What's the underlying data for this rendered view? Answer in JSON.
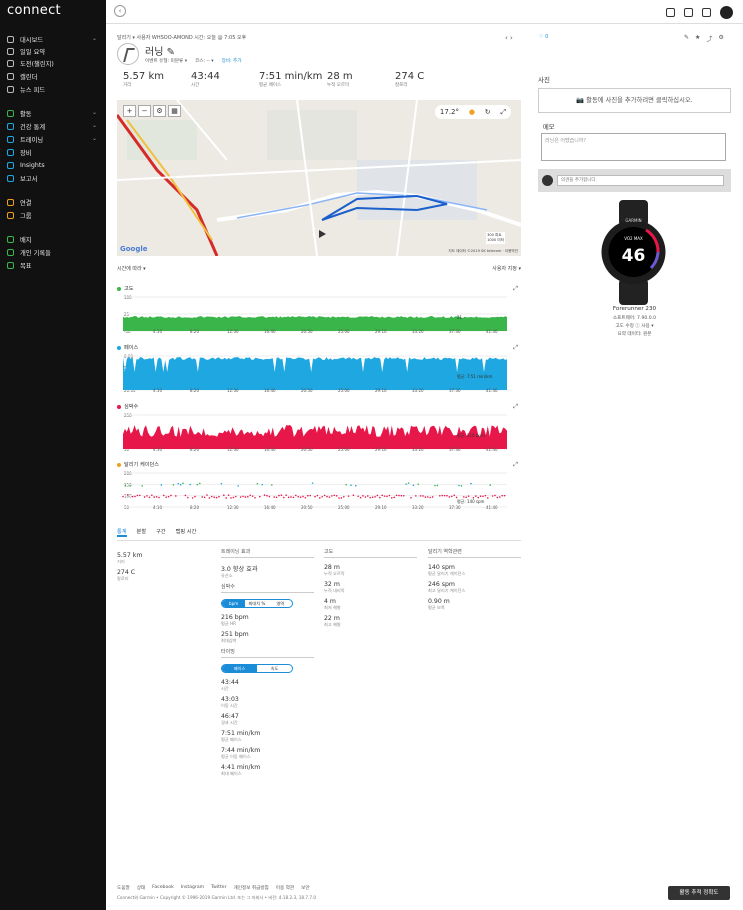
{
  "app": {
    "logo": "connect"
  },
  "sidebar": {
    "items": [
      {
        "label": "대시보드",
        "chev": true
      },
      {
        "label": "일일 요약"
      },
      {
        "label": "도전(챌린지)"
      },
      {
        "label": "캘린더"
      },
      {
        "label": "뉴스 피드"
      },
      {
        "label": "활동",
        "chev": true
      },
      {
        "label": "건강 통계",
        "chev": true
      },
      {
        "label": "트레이닝",
        "chev": true
      },
      {
        "label": "장비"
      },
      {
        "label": "Insights"
      },
      {
        "label": "보고서"
      },
      {
        "label": "연결"
      },
      {
        "label": "그룹"
      },
      {
        "label": "배지"
      },
      {
        "label": "개인 기록들"
      },
      {
        "label": "목표"
      }
    ]
  },
  "activity": {
    "breadcrumb": "달리기 ▾ 사용자 WHSOO-AMOND 시간: 오늘 @ 7:05 오후",
    "title": "러닝",
    "event_type": "이벤트 유형: 미분류 ▾",
    "course": "코스: -- ▾",
    "gear_label": "장비: 추가",
    "likes": "0"
  },
  "stats": [
    {
      "value": "5.57 km",
      "label": "거리"
    },
    {
      "value": "43:44",
      "label": "시간"
    },
    {
      "value": "7:51 min/km",
      "label": "평균 페이스"
    },
    {
      "value": "28 m",
      "label": "누적 오르막"
    },
    {
      "value": "274 C",
      "label": "칼로리"
    }
  ],
  "map": {
    "weather_temp": "17.2°",
    "attribution": "지도 데이터 ©2019 SK telecom · 이용약관",
    "scale1": "300 피트",
    "scale2": "1000 미터",
    "google": "Google"
  },
  "charts_header": {
    "left": "시간에 따라 ▾",
    "right": "사용자 지정 ▾"
  },
  "charts": [
    {
      "name": "고도",
      "color": "#3ab54a",
      "yticks": [
        "100",
        "25",
        "-50"
      ],
      "xticks": [
        "4:10",
        "8:20",
        "12:30",
        "16:40",
        "20:50",
        "25:00",
        "29:10",
        "33:20",
        "37:30",
        "41:40"
      ],
      "readout": "21",
      "kind": "elev"
    },
    {
      "name": "페이스",
      "color": "#1ea7e0",
      "yticks": [
        "0:00",
        "5:00",
        "10:00",
        "20:00"
      ],
      "xticks": [
        "4:10",
        "8:20",
        "12:30",
        "16:40",
        "20:50",
        "25:00",
        "29:10",
        "33:20",
        "37:30",
        "41:40"
      ],
      "readout": "평균: 7:51 min/km",
      "kind": "pace"
    },
    {
      "name": "심박수",
      "color": "#e8174a",
      "yticks": [
        "250",
        "50"
      ],
      "xticks": [
        "4:10",
        "8:20",
        "12:30",
        "16:40",
        "20:50",
        "25:00",
        "29:10",
        "33:20",
        "37:30",
        "41:40"
      ],
      "readout": "평균: 216 bpm",
      "kind": "hr"
    },
    {
      "name": "달리기 케이던스",
      "color": "#f0a020",
      "yticks": [
        "200",
        "150",
        "100",
        "50"
      ],
      "xticks": [
        "4:10",
        "8:20",
        "12:30",
        "16:40",
        "20:50",
        "25:00",
        "29:10",
        "33:20",
        "37:30",
        "41:40"
      ],
      "readout": "평균: 140 spm",
      "kind": "cad"
    }
  ],
  "tabs": [
    "통계",
    "분할",
    "구간",
    "랩핑 시간"
  ],
  "details": {
    "col1": [
      {
        "v": "5.57 km",
        "l": "거리"
      },
      {
        "v": "274 C",
        "l": "칼로리"
      }
    ],
    "training_h": "트레이닝 효과",
    "training": [
      {
        "v": "3.0 향상 효과",
        "l": "유산소"
      }
    ],
    "hr_h": "심박수",
    "hr_seg": [
      "bpm",
      "최대치 %",
      "영역"
    ],
    "hr": [
      {
        "v": "216 bpm",
        "l": "평균 HR"
      },
      {
        "v": "251 bpm",
        "l": "최대심박"
      }
    ],
    "timing_h": "타이밍",
    "timing_seg": [
      "페이스",
      "속도"
    ],
    "timing": [
      {
        "v": "43:44",
        "l": "시간"
      },
      {
        "v": "43:03",
        "l": "이동 시간"
      },
      {
        "v": "46:47",
        "l": "경과 시간"
      },
      {
        "v": "7:51 min/km",
        "l": "평균 페이스"
      },
      {
        "v": "7:44 min/km",
        "l": "평균 이동 페이스"
      },
      {
        "v": "4:41 min/km",
        "l": "최대 페이스"
      }
    ],
    "elev_h": "고도",
    "elev": [
      {
        "v": "28 m",
        "l": "누적 오르막"
      },
      {
        "v": "32 m",
        "l": "누적 내리막"
      },
      {
        "v": "4 m",
        "l": "최저 해발"
      },
      {
        "v": "22 m",
        "l": "최고 해발"
      }
    ],
    "run_h": "달리기 역학관련",
    "run": [
      {
        "v": "140 spm",
        "l": "평균 달리기 케이던스"
      },
      {
        "v": "246 spm",
        "l": "최고 달리기 케이던스"
      },
      {
        "v": "0.90 m",
        "l": "평균 보폭"
      }
    ]
  },
  "photos": {
    "heading": "사진",
    "add": "활동에 사진을 추가하려면 클릭하십시오."
  },
  "notes": {
    "heading": "메모",
    "placeholder": "러닝은 어땠습니까?",
    "comment_ph": "의견을 추가합니다."
  },
  "device": {
    "name": "Forerunner 230",
    "firmware": "소프트웨어: 7.90.0.0",
    "elev_src": "고도 수정 ⓘ 사용 ▾",
    "summary": "요약 데이터: 원본",
    "watch_time": "46",
    "watch_brand": "GARMIN",
    "watch_top": "VO2 MAX"
  },
  "footer": {
    "links": [
      "도움말",
      "상태",
      "Facebook",
      "Instagram",
      "Twitter",
      "개인정보 취급방침",
      "이용 약관",
      "보안"
    ],
    "copy": "Connect와 Garmin • Copyright © 1996-2019 Garmin Ltd. 또는 그 자회사 • 버전: 4.18.2.3, 18.7.7.0"
  },
  "help_button": "활동 추적 정확도"
}
